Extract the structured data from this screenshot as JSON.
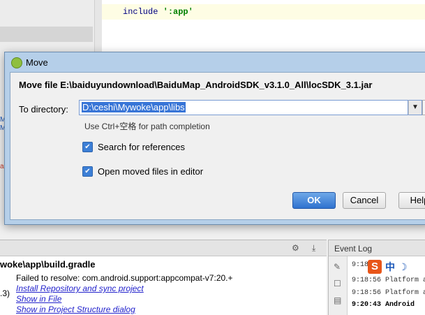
{
  "editor": {
    "code_keyword": "include",
    "code_string": "':app'"
  },
  "dialog": {
    "title": "Move",
    "headline": "Move file E:\\baiduyundownload\\BaiduMap_AndroidSDK_v3.1.0_All\\locSDK_3.1.jar",
    "to_directory_label": "To directory:",
    "to_directory_value": "D:\\ceshi\\Mywoke\\app\\libs",
    "path_hint": "Use Ctrl+空格 for path completion",
    "search_references_label": "Search for references",
    "search_references_checked": true,
    "open_in_editor_label": "Open moved files in editor",
    "open_in_editor_checked": true,
    "ok_label": "OK",
    "cancel_label": "Cancel",
    "help_label": "Help"
  },
  "messages": {
    "title": "woke\\app\\build.gradle",
    "left_fragment": ".3)",
    "lines": [
      "Failed to resolve: com.android.support:appcompat-v7:20.+",
      "Install Repository and sync project",
      "Show in File",
      "Show in Project Structure dialog"
    ]
  },
  "event_log": {
    "title": "Event Log",
    "lines": [
      "9:18",
      "9:18:56 Platform a",
      "9:18:56 Platform a",
      "9:20:43 Android"
    ]
  },
  "ime": {
    "logo": "S",
    "lang": "中"
  },
  "icons": [
    "android-icon",
    "dropdown-arrow-icon",
    "checkbox-icon",
    "gear-icon",
    "pin-icon",
    "wrench-icon",
    "moon-icon"
  ]
}
